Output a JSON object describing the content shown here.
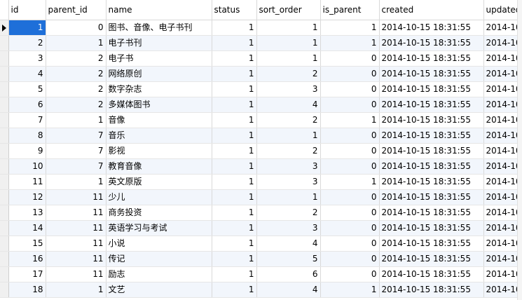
{
  "columns": [
    {
      "label": "id"
    },
    {
      "label": "parent_id"
    },
    {
      "label": "name"
    },
    {
      "label": "status"
    },
    {
      "label": "sort_order"
    },
    {
      "label": "is_parent"
    },
    {
      "label": "created"
    },
    {
      "label": "updated"
    }
  ],
  "rows": [
    {
      "id": "1",
      "parent_id": "0",
      "name": "图书、音像、电子书刊",
      "status": "1",
      "sort_order": "1",
      "is_parent": "1",
      "created": "2014-10-15 18:31:55",
      "updated": "2014-10-"
    },
    {
      "id": "2",
      "parent_id": "1",
      "name": "电子书刊",
      "status": "1",
      "sort_order": "1",
      "is_parent": "1",
      "created": "2014-10-15 18:31:55",
      "updated": "2014-10-"
    },
    {
      "id": "3",
      "parent_id": "2",
      "name": "电子书",
      "status": "1",
      "sort_order": "1",
      "is_parent": "0",
      "created": "2014-10-15 18:31:55",
      "updated": "2014-10-"
    },
    {
      "id": "4",
      "parent_id": "2",
      "name": "网络原创",
      "status": "1",
      "sort_order": "2",
      "is_parent": "0",
      "created": "2014-10-15 18:31:55",
      "updated": "2014-10-"
    },
    {
      "id": "5",
      "parent_id": "2",
      "name": "数字杂志",
      "status": "1",
      "sort_order": "3",
      "is_parent": "0",
      "created": "2014-10-15 18:31:55",
      "updated": "2014-10-"
    },
    {
      "id": "6",
      "parent_id": "2",
      "name": "多媒体图书",
      "status": "1",
      "sort_order": "4",
      "is_parent": "0",
      "created": "2014-10-15 18:31:55",
      "updated": "2014-10-"
    },
    {
      "id": "7",
      "parent_id": "1",
      "name": "音像",
      "status": "1",
      "sort_order": "2",
      "is_parent": "1",
      "created": "2014-10-15 18:31:55",
      "updated": "2014-10-"
    },
    {
      "id": "8",
      "parent_id": "7",
      "name": "音乐",
      "status": "1",
      "sort_order": "1",
      "is_parent": "0",
      "created": "2014-10-15 18:31:55",
      "updated": "2014-10-"
    },
    {
      "id": "9",
      "parent_id": "7",
      "name": "影视",
      "status": "1",
      "sort_order": "2",
      "is_parent": "0",
      "created": "2014-10-15 18:31:55",
      "updated": "2014-10-"
    },
    {
      "id": "10",
      "parent_id": "7",
      "name": "教育音像",
      "status": "1",
      "sort_order": "3",
      "is_parent": "0",
      "created": "2014-10-15 18:31:55",
      "updated": "2014-10-"
    },
    {
      "id": "11",
      "parent_id": "1",
      "name": "英文原版",
      "status": "1",
      "sort_order": "3",
      "is_parent": "1",
      "created": "2014-10-15 18:31:55",
      "updated": "2014-10-"
    },
    {
      "id": "12",
      "parent_id": "11",
      "name": "少儿",
      "status": "1",
      "sort_order": "1",
      "is_parent": "0",
      "created": "2014-10-15 18:31:55",
      "updated": "2014-10-"
    },
    {
      "id": "13",
      "parent_id": "11",
      "name": "商务投资",
      "status": "1",
      "sort_order": "2",
      "is_parent": "0",
      "created": "2014-10-15 18:31:55",
      "updated": "2014-10-"
    },
    {
      "id": "14",
      "parent_id": "11",
      "name": "英语学习与考试",
      "status": "1",
      "sort_order": "3",
      "is_parent": "0",
      "created": "2014-10-15 18:31:55",
      "updated": "2014-10-"
    },
    {
      "id": "15",
      "parent_id": "11",
      "name": "小说",
      "status": "1",
      "sort_order": "4",
      "is_parent": "0",
      "created": "2014-10-15 18:31:55",
      "updated": "2014-10-"
    },
    {
      "id": "16",
      "parent_id": "11",
      "name": "传记",
      "status": "1",
      "sort_order": "5",
      "is_parent": "0",
      "created": "2014-10-15 18:31:55",
      "updated": "2014-10-"
    },
    {
      "id": "17",
      "parent_id": "11",
      "name": "励志",
      "status": "1",
      "sort_order": "6",
      "is_parent": "0",
      "created": "2014-10-15 18:31:55",
      "updated": "2014-10-"
    },
    {
      "id": "18",
      "parent_id": "1",
      "name": "文艺",
      "status": "1",
      "sort_order": "4",
      "is_parent": "1",
      "created": "2014-10-15 18:31:55",
      "updated": "2014-10-"
    }
  ],
  "selection": {
    "row": 0,
    "column": "id",
    "indicator_icon": "row-pointer-icon",
    "highlight_color": "#1e6fd9"
  },
  "alt_row_color": "#f2f6fc"
}
